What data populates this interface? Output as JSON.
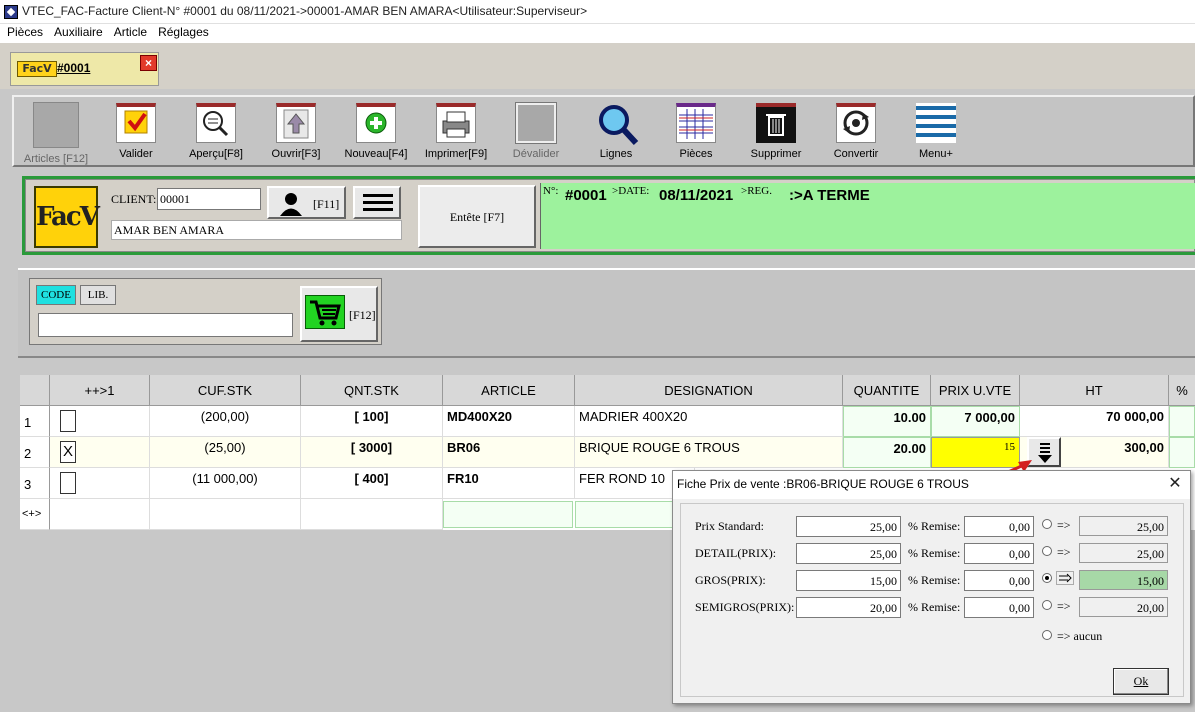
{
  "window": {
    "title": "VTEC_FAC-Facture Client-N° #0001 du 08/11/2021->00001-AMAR BEN AMARA<Utilisateur:Superviseur>"
  },
  "menu": [
    "Pièces",
    "Auxiliaire",
    "Article",
    "Réglages"
  ],
  "doc_tab": {
    "logo": "FacV",
    "label": "#0001",
    "close": "×"
  },
  "toolbar": [
    {
      "label": "Articles [F12]",
      "icon": "blank-icon",
      "disabled": true
    },
    {
      "label": "Valider",
      "icon": "check-icon"
    },
    {
      "label": "Aperçu[F8]",
      "icon": "magnifier-icon"
    },
    {
      "label": "Ouvrir[F3]",
      "icon": "up-arrow-icon"
    },
    {
      "label": "Nouveau[F4]",
      "icon": "plus-icon"
    },
    {
      "label": "Imprimer[F9]",
      "icon": "printer-icon"
    },
    {
      "label": "Dévalider",
      "icon": "blank-icon",
      "disabled": true
    },
    {
      "label": "Lignes",
      "icon": "search-icon"
    },
    {
      "label": "Pièces",
      "icon": "grid-icon"
    },
    {
      "label": "Supprimer",
      "icon": "trash-icon"
    },
    {
      "label": "Convertir",
      "icon": "convert-icon"
    },
    {
      "label": "Menu+",
      "icon": "lines-icon"
    }
  ],
  "client": {
    "logo": "FacV",
    "label": "CLIENT:",
    "code": "00001",
    "name": "AMAR BEN AMARA",
    "client_button": "[F11]",
    "entete_button": "Entête [F7]"
  },
  "info": {
    "num_label": "N°:",
    "num_value": "#0001",
    "date_label": ">DATE:",
    "date_value": "08/11/2021",
    "reg_label": ">REG.",
    "reg_value": ":>A TERME"
  },
  "search": {
    "code_label": "CODE",
    "lib_label": "LIB.",
    "cart_button": "[F12]",
    "value": ""
  },
  "grid": {
    "columns": [
      "",
      "++>1",
      "CUF.STK",
      "QNT.STK",
      "ARTICLE",
      "DESIGNATION",
      "QUANTITE",
      "PRIX U.VTE",
      "HT",
      "%"
    ],
    "rows": [
      {
        "num": "1",
        "check": "",
        "cuf": "(200,00)",
        "qnt": "[ 100]",
        "article": "MD400X20",
        "designation": "MADRIER 400X20",
        "quantite": "10.00",
        "prix": "7 000,00",
        "ht": "70 000,00"
      },
      {
        "num": "2",
        "check": "X",
        "cuf": "(25,00)",
        "qnt": "[ 3000]",
        "article": "BR06",
        "designation": "BRIQUE ROUGE 6 TROUS",
        "quantite": "20.00",
        "prix": "15",
        "ht": "300,00"
      },
      {
        "num": "3",
        "check": "",
        "cuf": "(11 000,00)",
        "qnt": "[ 400]",
        "article": "FR10",
        "designation": "FER ROND 10",
        "quantite": "",
        "prix": "",
        "ht": ""
      }
    ],
    "new_row": "<+>"
  },
  "dialog": {
    "title": "Fiche Prix de vente :BR06-BRIQUE ROUGE 6 TROUS",
    "close": "✕",
    "remise_label": "% Remise:",
    "arrow": "=>",
    "rows": [
      {
        "label": "Prix Standard:",
        "price": "25,00",
        "remise": "0,00",
        "result": "25,00",
        "selected": false
      },
      {
        "label": "DETAIL(PRIX):",
        "price": "25,00",
        "remise": "0,00",
        "result": "25,00",
        "selected": false
      },
      {
        "label": "GROS(PRIX):",
        "price": "15,00",
        "remise": "0,00",
        "result": "15,00",
        "selected": true
      },
      {
        "label": "SEMIGROS(PRIX):",
        "price": "20,00",
        "remise": "0,00",
        "result": "20,00",
        "selected": false
      }
    ],
    "none_label": "=> aucun",
    "ok": "Ok"
  },
  "colors": {
    "accent_green": "#9df29d",
    "yellow": "#ffff00",
    "cyan": "#1fe0e0",
    "annotation_red": "#d42020"
  }
}
